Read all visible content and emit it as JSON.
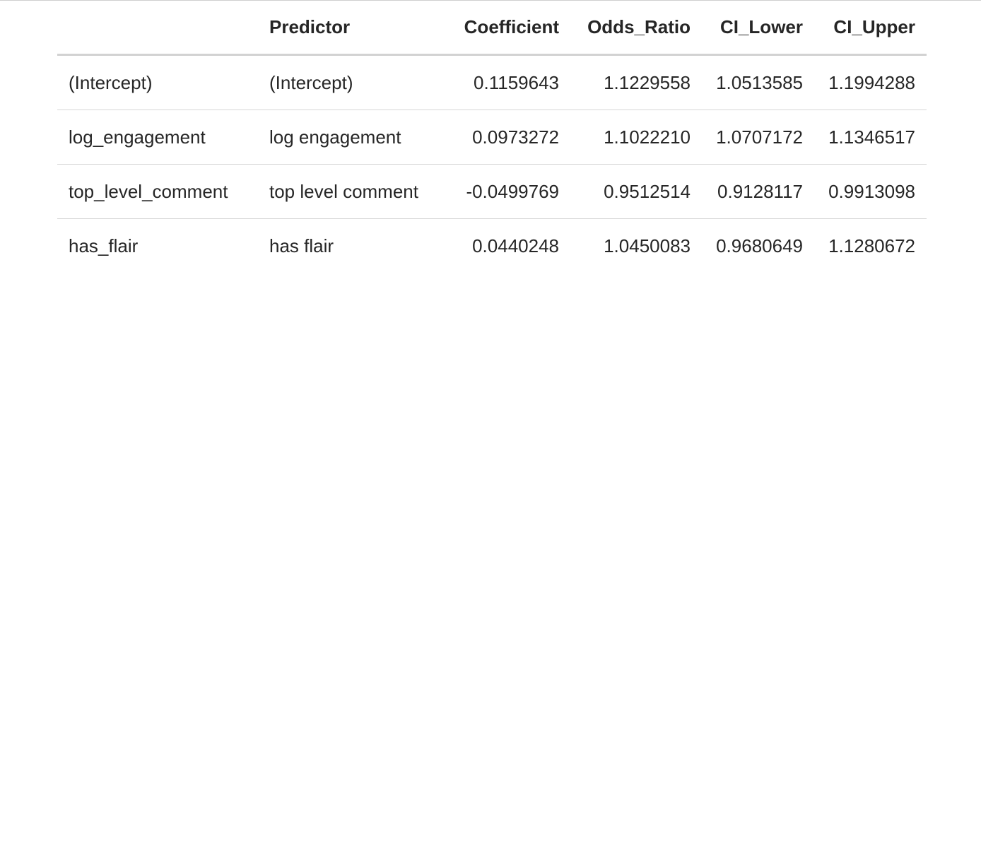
{
  "table": {
    "columns": [
      "",
      "Predictor",
      "Coefficient",
      "Odds_Ratio",
      "CI_Lower",
      "CI_Upper"
    ],
    "rows": [
      [
        "(Intercept)",
        "(Intercept)",
        "0.1159643",
        "1.1229558",
        "1.0513585",
        "1.1994288"
      ],
      [
        "log_engagement",
        "log engagement",
        "0.0973272",
        "1.1022210",
        "1.0707172",
        "1.1346517"
      ],
      [
        "top_level_comment",
        "top level comment",
        "-0.0499769",
        "0.9512514",
        "0.9128117",
        "0.9913098"
      ],
      [
        "has_flair",
        "has flair",
        "0.0440248",
        "1.0450083",
        "0.9680649",
        "1.1280672"
      ]
    ]
  }
}
